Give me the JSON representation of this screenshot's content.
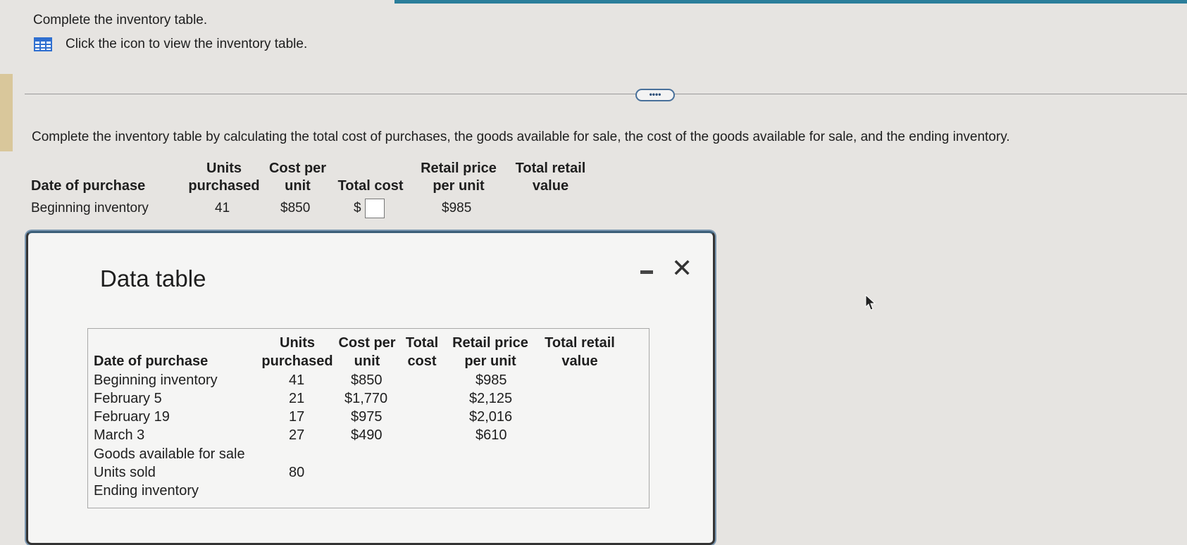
{
  "instructions": "Complete the inventory table.",
  "icon_link_text": "Click the icon to view the inventory table.",
  "more_label": "••••",
  "question": "Complete the inventory table by calculating the total cost of purchases, the goods available for sale, the cost of the goods available for sale, and the ending inventory.",
  "table": {
    "headers": {
      "date": "Date of purchase",
      "units": [
        "Units",
        "purchased"
      ],
      "cost_per_unit": [
        "Cost per",
        "unit"
      ],
      "total_cost": "Total cost",
      "retail_price": [
        "Retail price",
        "per unit"
      ],
      "total_retail": [
        "Total retail",
        "value"
      ]
    },
    "row": {
      "date": "Beginning inventory",
      "units": "41",
      "cost_per_unit": "$850",
      "currency": "$",
      "retail_price": "$985"
    }
  },
  "modal": {
    "title": "Data table",
    "headers": {
      "date": "Date of purchase",
      "units": [
        "Units",
        "purchased"
      ],
      "cost_per_unit": [
        "Cost per",
        "unit"
      ],
      "total_cost": [
        "Total",
        "cost"
      ],
      "retail_price": [
        "Retail price",
        "per unit"
      ],
      "total_retail": [
        "Total retail",
        "value"
      ]
    },
    "rows": [
      {
        "date": "Beginning inventory",
        "units": "41",
        "cost": "$850",
        "retail": "$985"
      },
      {
        "date": "February 5",
        "units": "21",
        "cost": "$1,770",
        "retail": "$2,125"
      },
      {
        "date": "February 19",
        "units": "17",
        "cost": "$975",
        "retail": "$2,016"
      },
      {
        "date": "March 3",
        "units": "27",
        "cost": "$490",
        "retail": "$610"
      },
      {
        "date": "Goods available for sale",
        "units": "",
        "cost": "",
        "retail": ""
      },
      {
        "date": "Units sold",
        "units": "80",
        "cost": "",
        "retail": ""
      },
      {
        "date": "Ending inventory",
        "units": "",
        "cost": "",
        "retail": ""
      }
    ]
  },
  "colors": {
    "accent": "#2b7e9a",
    "icon_blue": "#2f6fd0"
  },
  "icons": [
    "grid-table-icon",
    "minimize-icon",
    "close-icon",
    "mouse-cursor-icon"
  ]
}
